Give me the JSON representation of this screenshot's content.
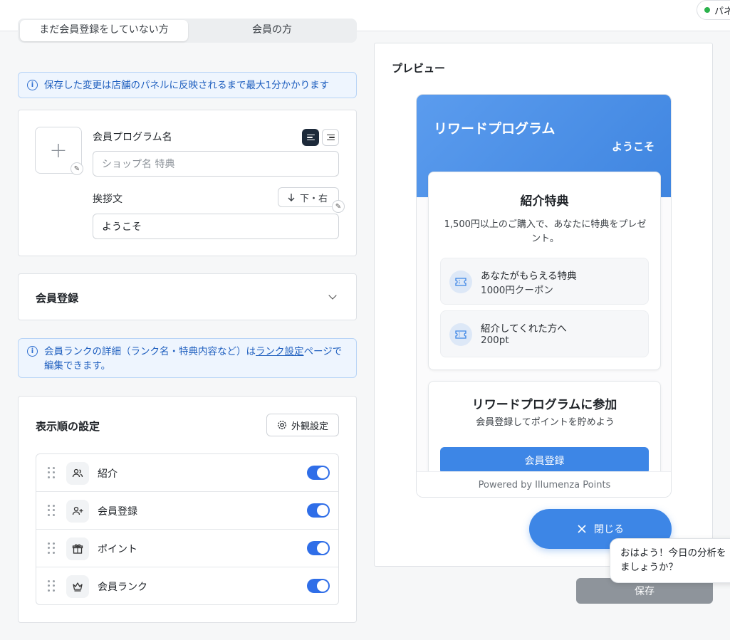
{
  "topbar": {
    "status_text": "パネ"
  },
  "tabs": [
    {
      "label": "まだ会員登録をしていない方"
    },
    {
      "label": "会員の方"
    }
  ],
  "info_sync": {
    "text": "保存した変更は店舗のパネルに反映されるまで最大1分かかります"
  },
  "program_card": {
    "name_label": "会員プログラム名",
    "name_placeholder": "ショップ名 特典",
    "greeting_label": "挨拶文",
    "greeting_value": "ようこそ",
    "direction_button": "下・右"
  },
  "signup_section": {
    "title": "会員登録"
  },
  "info_rank": {
    "text_before": "会員ランクの詳細（ランク名・特典内容など）は",
    "link": "ランク設定",
    "text_after": "ページで編集できます。"
  },
  "display_order": {
    "title": "表示順の設定",
    "appearance_button": "外観設定",
    "rows": [
      {
        "label": "紹介",
        "icon": "users-icon",
        "enabled": true
      },
      {
        "label": "会員登録",
        "icon": "user-plus-icon",
        "enabled": true
      },
      {
        "label": "ポイント",
        "icon": "gift-icon",
        "enabled": true
      },
      {
        "label": "会員ランク",
        "icon": "crown-icon",
        "enabled": true
      }
    ]
  },
  "preview": {
    "title": "プレビュー",
    "widget_title": "リワードプログラム",
    "welcome": "ようこそ",
    "referral": {
      "title": "紹介特典",
      "description": "1,500円以上のご購入で、あなたに特典をプレゼント。",
      "benefits": [
        {
          "label": "あなたがもらえる特典",
          "value": "1000円クーポン"
        },
        {
          "label": "紹介してくれた方へ",
          "value": "200pt"
        }
      ]
    },
    "join": {
      "title": "リワードプログラムに参加",
      "subtitle": "会員登録してポイントを貯めよう",
      "button": "会員登録"
    },
    "footer": "Powered by Illumenza Points"
  },
  "close_button": "閉じる",
  "save_button": "保存",
  "chat_bubble": "おはよう！今日の分析をましょうか？",
  "colors": {
    "accent": "#3d86e6",
    "toggle_on": "#2f6ee8",
    "info_text": "#1f5fbf",
    "save_disabled": "#8e949b"
  }
}
